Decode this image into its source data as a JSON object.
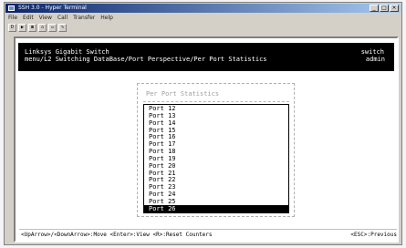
{
  "window": {
    "title": "SSH 3.0 - Hyper Terminal",
    "controls": [
      "_",
      "□",
      "×"
    ]
  },
  "menu": [
    "File",
    "Edit",
    "View",
    "Call",
    "Transfer",
    "Help"
  ],
  "toolbar": [
    "D",
    "▶",
    "☎",
    "⌂",
    "▭",
    "✎"
  ],
  "terminal": {
    "header": {
      "line1": "Linksys Gigabit Switch",
      "line2": " menu/L2 Switching DataBase/Port Perspective/Per Port Statistics",
      "right1": "switch",
      "right2": "admin"
    },
    "panel": {
      "title": "Per Port Statistics",
      "items": [
        "Port 12",
        "Port 13",
        "Port 14",
        "Port 15",
        "Port 16",
        "Port 17",
        "Port 18",
        "Port 19",
        "Port 20",
        "Port 21",
        "Port 22",
        "Port 23",
        "Port 24",
        "Port 25",
        "Port 26"
      ],
      "selected_index": 14
    },
    "footer": {
      "left": "<UpArrow>/<DownArrow>:Move  <Enter>:View  <R>:Reset Counters",
      "right": "<ESC>:Previous"
    }
  }
}
